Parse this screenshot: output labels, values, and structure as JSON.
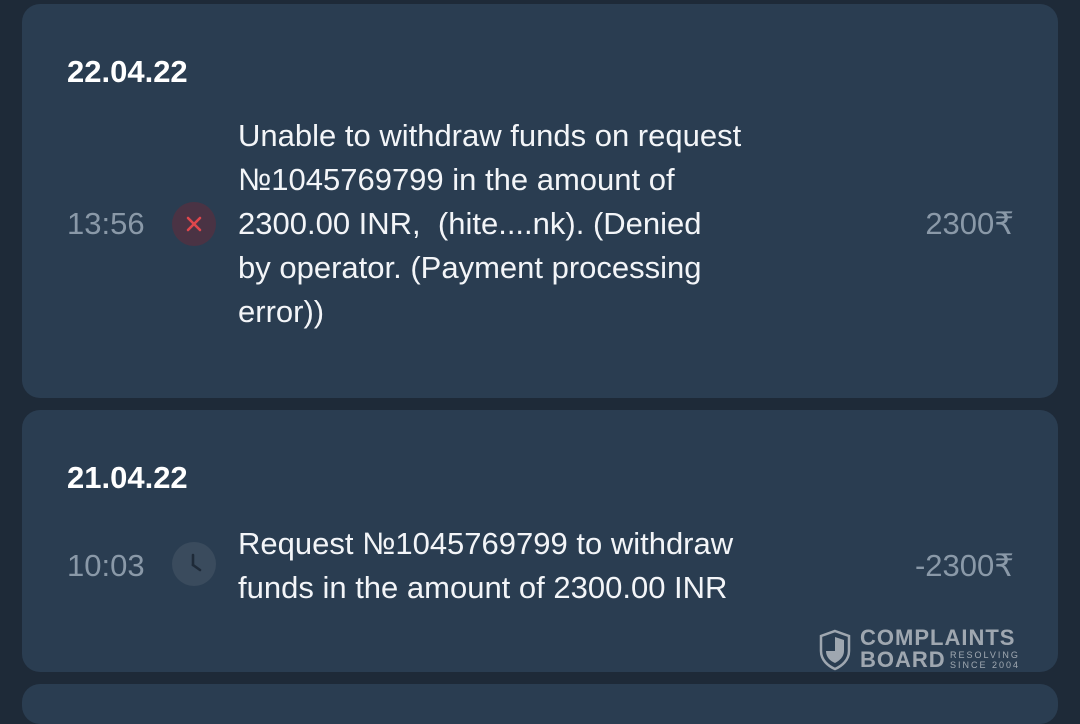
{
  "transactions": [
    {
      "date": "22.04.22",
      "time": "13:56",
      "status_icon": "close-icon",
      "description": "Unable to withdraw funds on request\n№1045769799 in the amount of\n2300.00 INR,  (hite....nk). (Denied\nby operator. (Payment processing\nerror))",
      "amount": "2300₹"
    },
    {
      "date": "21.04.22",
      "time": "10:03",
      "status_icon": "clock-icon",
      "description": "Request №1045769799 to withdraw\nfunds in the amount of 2300.00 INR",
      "amount": "-2300₹"
    }
  ],
  "watermark": {
    "line1": "COMPLAINTS",
    "line2": "BOARD",
    "tag1": "RESOLVING",
    "tag2": "SINCE 2004"
  },
  "colors": {
    "background": "#1e2a38",
    "card": "#2a3d51",
    "denied": "#e0474c",
    "muted": "#8a99a8"
  }
}
